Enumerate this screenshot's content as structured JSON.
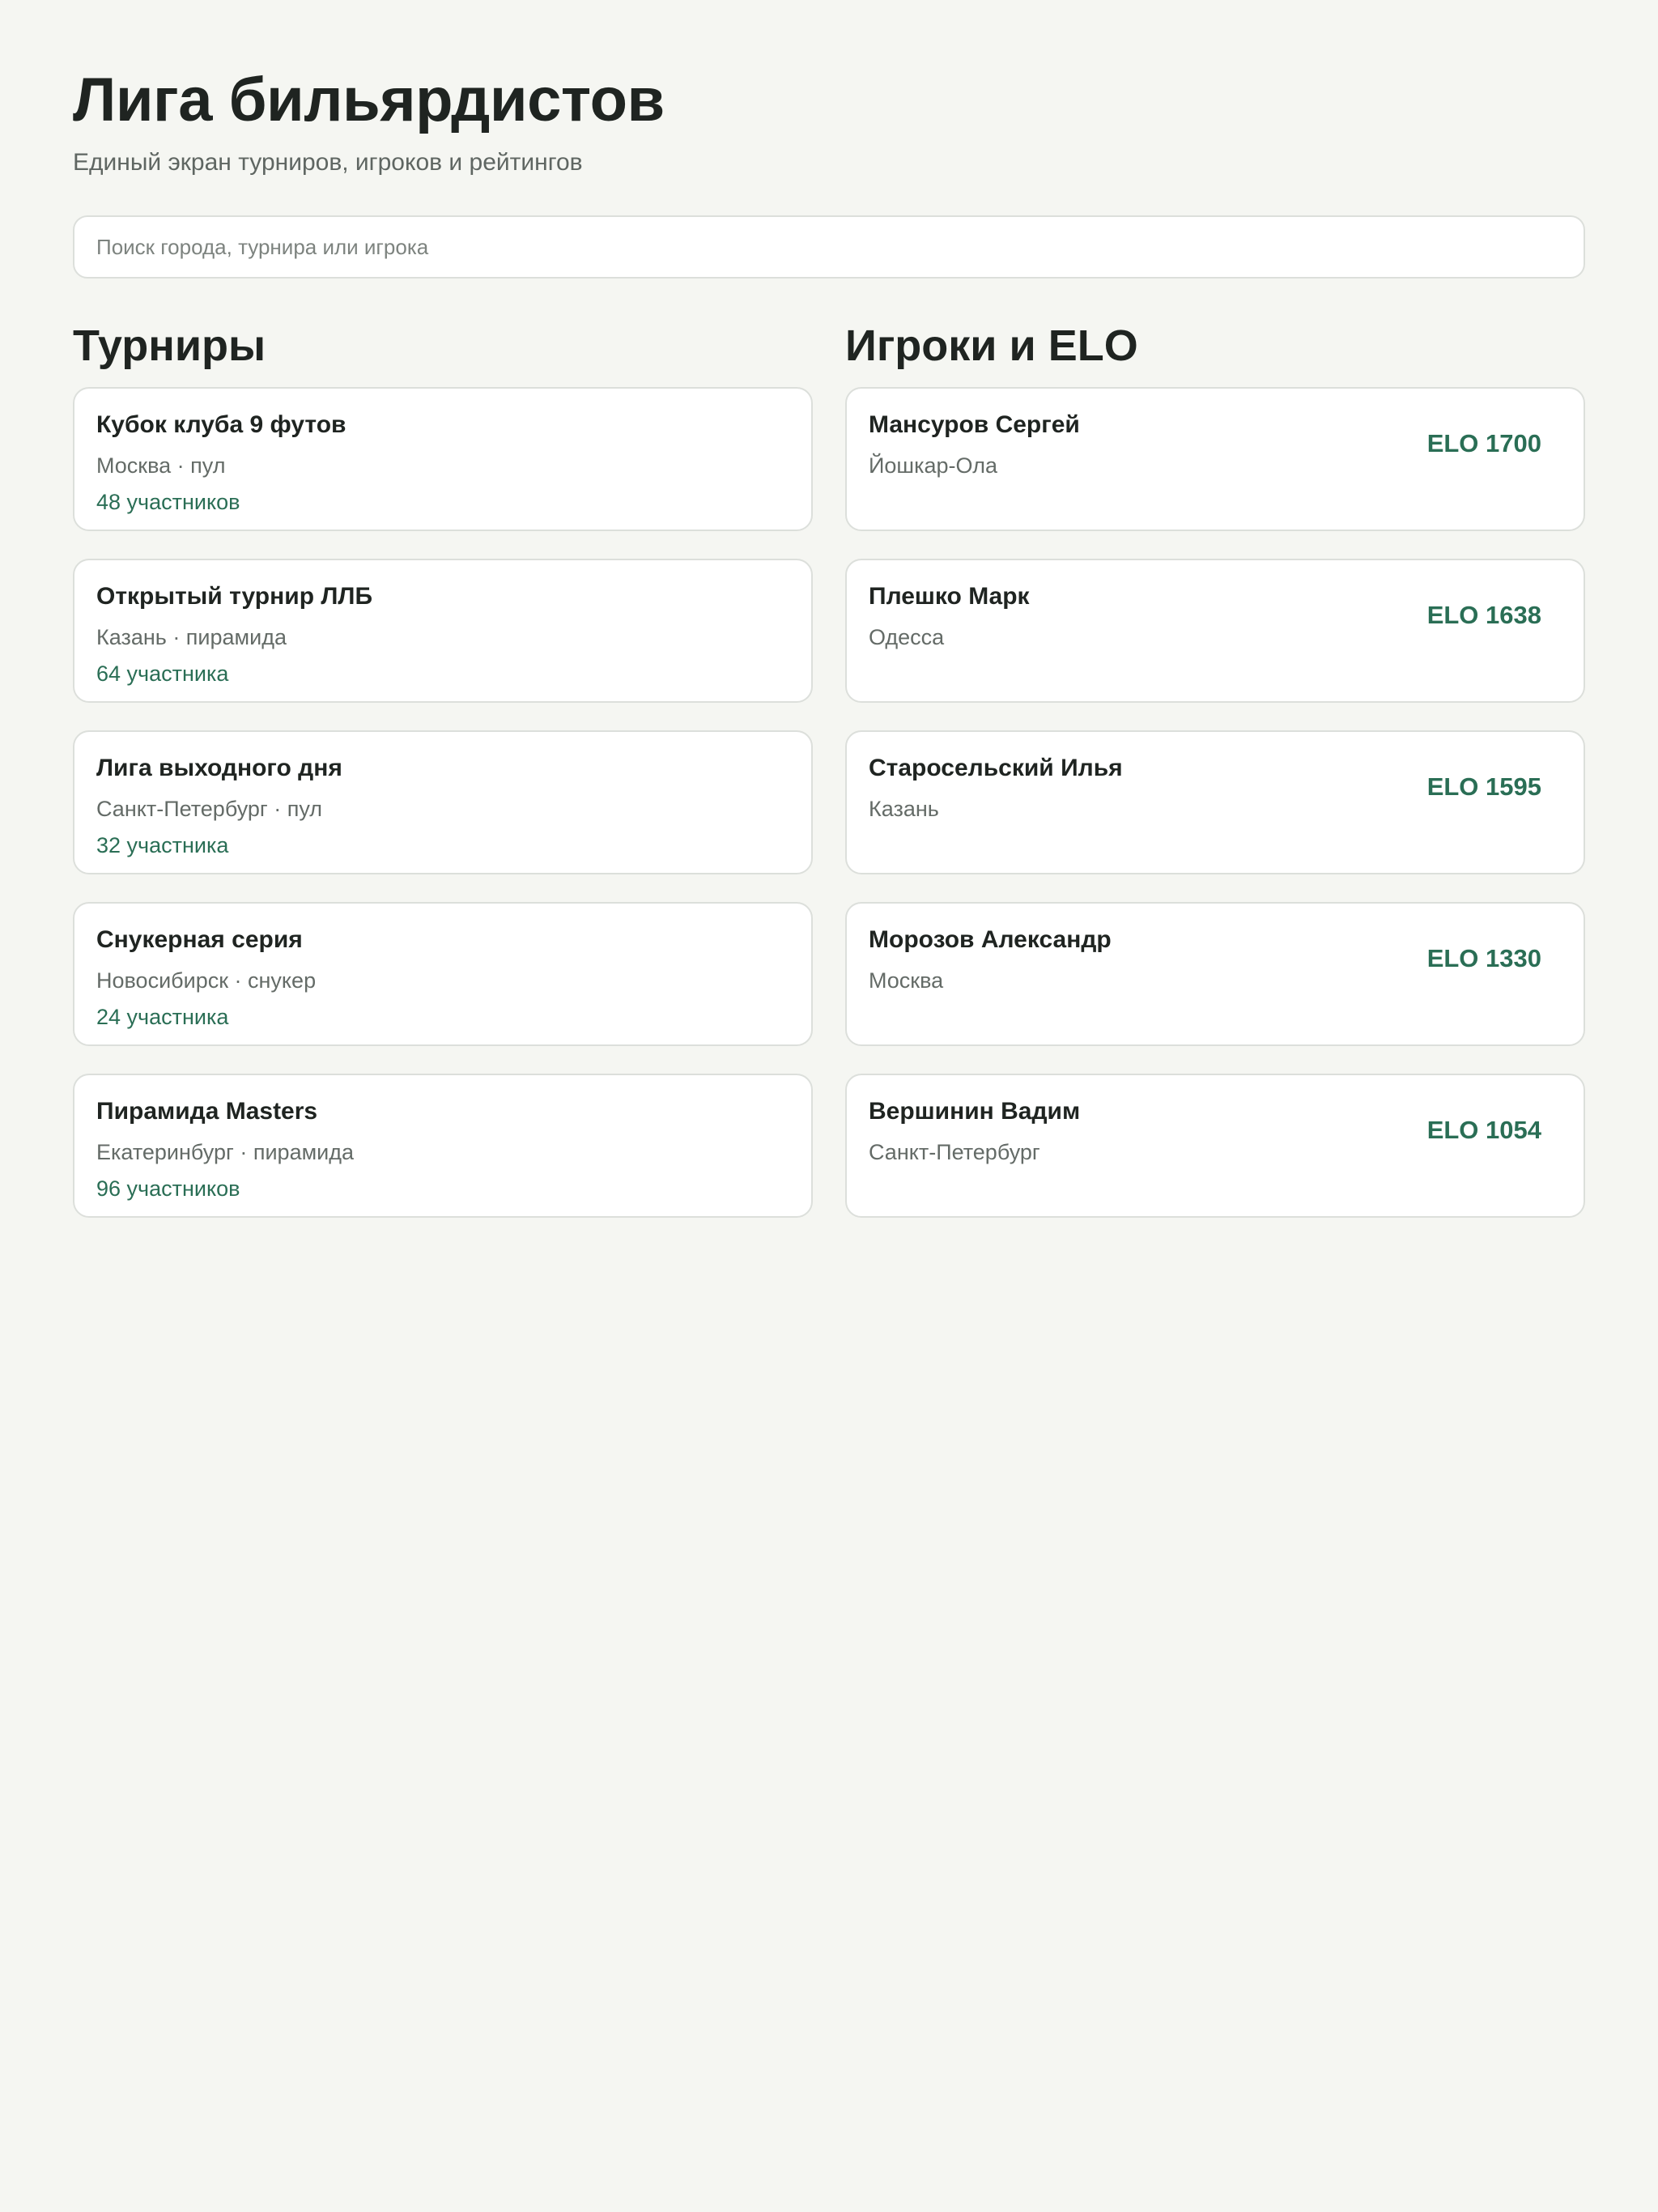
{
  "header": {
    "title": "Лига бильярдистов",
    "subtitle": "Единый экран турниров, игроков и рейтингов"
  },
  "search": {
    "placeholder": "Поиск города, турнира или игрока",
    "value": ""
  },
  "tournaments": {
    "heading": "Турниры",
    "items": [
      {
        "title": "Кубок клуба 9 футов",
        "meta": "Москва · пул",
        "participants": "48 участников"
      },
      {
        "title": "Открытый турнир ЛЛБ",
        "meta": "Казань · пирамида",
        "participants": "64 участника"
      },
      {
        "title": "Лига выходного дня",
        "meta": "Санкт-Петербург · пул",
        "participants": "32 участника"
      },
      {
        "title": "Снукерная серия",
        "meta": "Новосибирск · снукер",
        "participants": "24 участника"
      },
      {
        "title": "Пирамида Masters",
        "meta": "Екатеринбург · пирамида",
        "participants": "96 участников"
      }
    ]
  },
  "players": {
    "heading": "Игроки и ELO",
    "items": [
      {
        "name": "Мансуров Сергей",
        "city": "Йошкар-Ола",
        "elo": "ELO 1700"
      },
      {
        "name": "Плешко Марк",
        "city": "Одесса",
        "elo": "ELO 1638"
      },
      {
        "name": "Старосельский Илья",
        "city": "Казань",
        "elo": "ELO 1595"
      },
      {
        "name": "Морозов Александр",
        "city": "Москва",
        "elo": "ELO 1330"
      },
      {
        "name": "Вершинин Вадим",
        "city": "Санкт-Петербург",
        "elo": "ELO 1054"
      }
    ]
  },
  "colors": {
    "background": "#f5f6f2",
    "card": "#ffffff",
    "border": "#dcdfdb",
    "text": "#1f2421",
    "muted": "#646b67",
    "accent": "#2a6e55"
  }
}
